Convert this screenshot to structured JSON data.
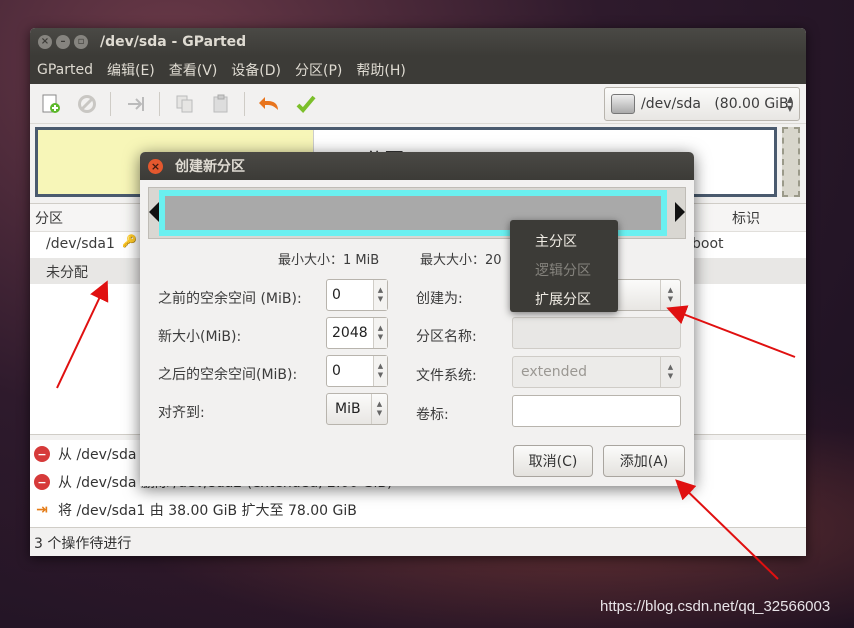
{
  "window": {
    "title": "/dev/sda - GParted",
    "menu": [
      "GParted",
      "编辑(E)",
      "查看(V)",
      "设备(D)",
      "分区(P)",
      "帮助(H)"
    ],
    "device_selector": "/dev/sda   (80.00 GiB)",
    "diskmap_label": "分区1"
  },
  "partition_table": {
    "headers": {
      "partition": "分区",
      "flags": "标识"
    },
    "rows": [
      {
        "partition": "/dev/sda1",
        "flags": "boot"
      },
      {
        "partition": "未分配",
        "flags": ""
      }
    ]
  },
  "operations": {
    "items": [
      {
        "type": "delete",
        "text": "从 /dev/sda 删除 /dev/sda3"
      },
      {
        "type": "delete",
        "text": "从 /dev/sda 删除 /dev/sda2 (extended, 2.00 GiB)"
      },
      {
        "type": "resize",
        "text": "将 /dev/sda1 由 38.00 GiB 扩大至 78.00 GiB"
      }
    ],
    "status": "3 个操作待进行"
  },
  "dialog": {
    "title": "创建新分区",
    "min_size": "最小大小：1 MiB",
    "max_size": "最大大小：20",
    "fields": {
      "free_before_label": "之前的空余空间 (MiB):",
      "free_before_value": "0",
      "new_size_label": "新大小(MiB):",
      "new_size_value": "2048",
      "free_after_label": "之后的空余空间(MiB):",
      "free_after_value": "0",
      "align_label": "对齐到:",
      "align_value": "MiB",
      "create_as_label": "创建为:",
      "partition_name_label": "分区名称:",
      "filesystem_label": "文件系统:",
      "filesystem_value": "extended",
      "volume_label_label": "卷标:"
    },
    "cancel_label": "取消(C)",
    "add_label": "添加(A)",
    "popup": [
      {
        "label": "主分区",
        "enabled": true
      },
      {
        "label": "逻辑分区",
        "enabled": false
      },
      {
        "label": "扩展分区",
        "enabled": true
      }
    ]
  },
  "watermark": "https://blog.csdn.net/qq_32566003",
  "colors": {
    "accent_cyan": "#6af0f0",
    "arrow_red": "#e01010",
    "partition_yellow": "#f7f6b8"
  },
  "icons": [
    "new-partition-icon",
    "delete-icon",
    "resize-icon",
    "copy-icon",
    "paste-icon",
    "undo-icon",
    "apply-icon",
    "disk-icon"
  ]
}
